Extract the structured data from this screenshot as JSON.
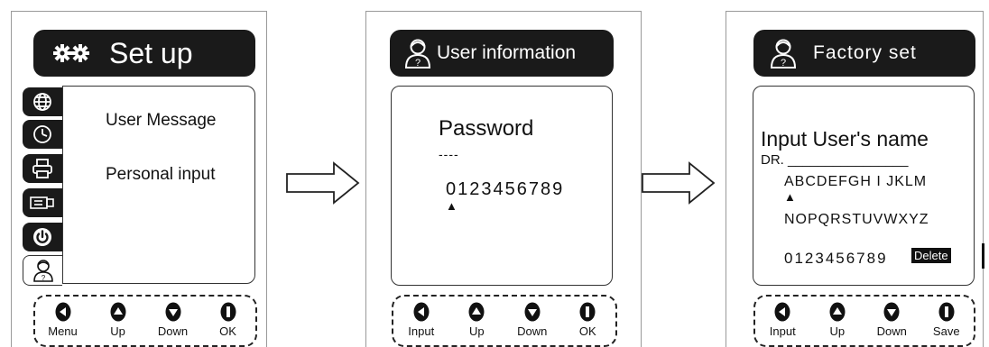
{
  "panels": [
    {
      "title": "Set up",
      "menu_items": [
        "User Message",
        "Personal input"
      ],
      "sidebar_icons": [
        "globe-icon",
        "clock-icon",
        "printer-icon",
        "usb-icon",
        "power-icon",
        "user-icon"
      ],
      "buttons": [
        "Menu",
        "Up",
        "Down",
        "OK"
      ]
    },
    {
      "title": "User information",
      "prompt": "Password",
      "entry": "----",
      "digits": "0123456789",
      "cursor": "▲",
      "buttons": [
        "Input",
        "Up",
        "Down",
        "OK"
      ]
    },
    {
      "title": "Factory set",
      "prompt": "Input User's name",
      "entry": "DR. ________________",
      "row1": "ABCDEFGH I JKLM",
      "cursor": "▲",
      "row2": "NOPQRSTUVWXYZ",
      "row3": "0123456789",
      "delete_label": "Delete",
      "buttons": [
        "Input",
        "Up",
        "Down",
        "Save"
      ]
    }
  ],
  "colors": {
    "screen_bg": "#1a1a1a",
    "foreground": "#ffffff",
    "line": "#222222"
  }
}
